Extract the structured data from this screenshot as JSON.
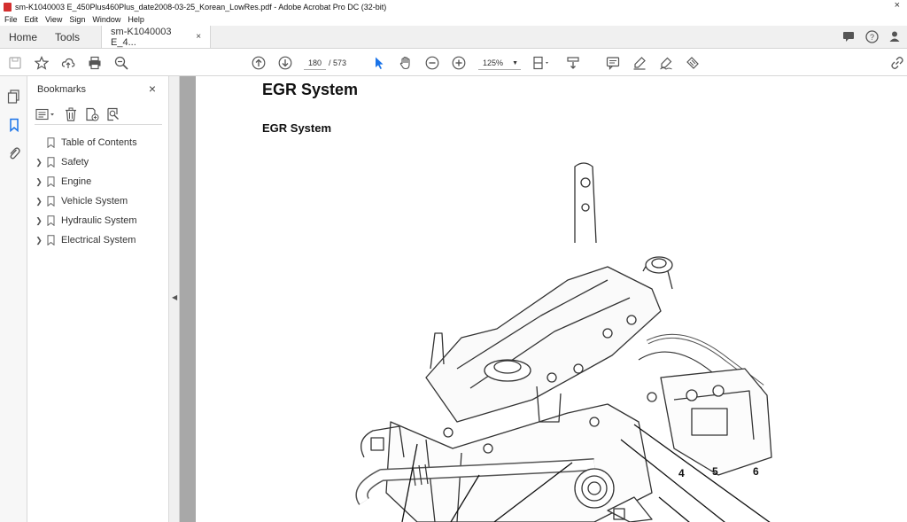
{
  "window": {
    "title": "sm-K1040003 E_450Plus460Plus_date2008-03-25_Korean_LowRes.pdf - Adobe Acrobat Pro DC (32-bit)",
    "close_glyph": "×"
  },
  "menu": [
    "File",
    "Edit",
    "View",
    "Sign",
    "Window",
    "Help"
  ],
  "tabs": {
    "home": "Home",
    "tools": "Tools",
    "document": "sm-K1040003 E_4...",
    "close_glyph": "×"
  },
  "toolbar": {
    "current_page": "180",
    "page_separator": "/",
    "total_pages": "573",
    "zoom": "125%"
  },
  "bookmarks": {
    "title": "Bookmarks",
    "close_glyph": "×",
    "items": [
      {
        "label": "Table of Contents",
        "expandable": false
      },
      {
        "label": "Safety",
        "expandable": true
      },
      {
        "label": "Engine",
        "expandable": true
      },
      {
        "label": "Vehicle System",
        "expandable": true
      },
      {
        "label": "Hydraulic System",
        "expandable": true
      },
      {
        "label": "Electrical System",
        "expandable": true
      }
    ]
  },
  "document": {
    "heading": "EGR System",
    "subheading": "EGR System",
    "callouts": [
      "4",
      "5",
      "6"
    ]
  },
  "icons": {
    "accent": "#1a73e8"
  }
}
